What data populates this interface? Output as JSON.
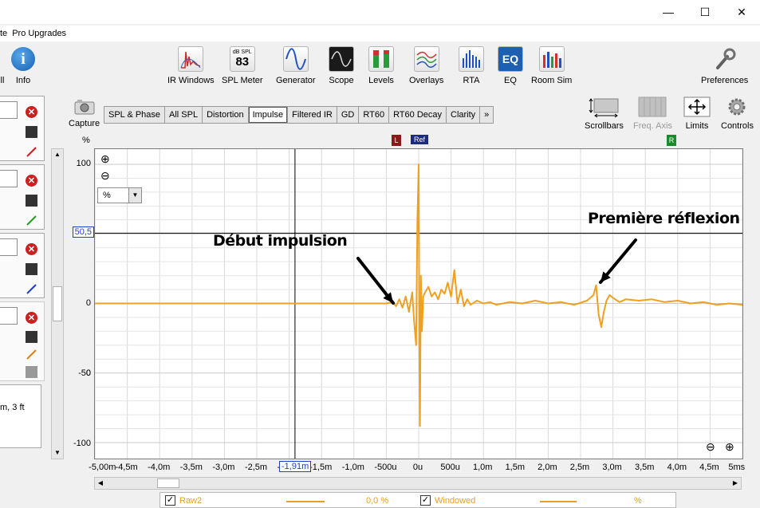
{
  "menu": {
    "items": [
      "te",
      "Pro Upgrades"
    ]
  },
  "window_controls": {
    "minimize": "—",
    "maximize": "☐",
    "close": "✕"
  },
  "toolbar": {
    "left_labels": [
      "ll",
      "Info"
    ],
    "buttons": [
      {
        "label": "IR Windows",
        "icon": "ir-windows-icon"
      },
      {
        "label": "SPL Meter",
        "icon": "spl-meter-icon",
        "icon_text_top": "dB SPL",
        "icon_text_value": "83"
      },
      {
        "label": "Generator",
        "icon": "generator-icon"
      },
      {
        "label": "Scope",
        "icon": "scope-icon"
      },
      {
        "label": "Levels",
        "icon": "levels-icon"
      },
      {
        "label": "Overlays",
        "icon": "overlays-icon"
      },
      {
        "label": "RTA",
        "icon": "rta-icon"
      },
      {
        "label": "EQ",
        "icon": "eq-icon",
        "icon_text": "EQ"
      },
      {
        "label": "Room Sim",
        "icon": "room-sim-icon"
      },
      {
        "label": "Preferences",
        "icon": "preferences-icon"
      }
    ]
  },
  "left_panel": {
    "info_text": "m, 3 ft",
    "line_colors": [
      "#d02020",
      "#20a020",
      "#2040c0",
      "#e08020"
    ]
  },
  "capture": {
    "label": "Capture"
  },
  "tabs": {
    "items": [
      "SPL & Phase",
      "All SPL",
      "Distortion",
      "Impulse",
      "Filtered IR",
      "GD",
      "RT60",
      "RT60 Decay",
      "Clarity",
      "»"
    ],
    "active": "Impulse"
  },
  "right_controls": {
    "scrollbars": "Scrollbars",
    "freq_axis": "Freq. Axis",
    "limits": "Limits",
    "controls": "Controls"
  },
  "plot": {
    "y_unit": "%",
    "unit_select": "%",
    "cursor_y": "50,5",
    "cursor_x": "-1,91m",
    "markers": {
      "left": "L",
      "ref": "Ref",
      "right": "R"
    },
    "annotations": {
      "start": "Début impulsion",
      "reflection": "Première réflexion"
    },
    "zoom_in": "⊕",
    "zoom_out": "⊖"
  },
  "chart_data": {
    "type": "line",
    "x_unit": "ms",
    "y_unit": "%",
    "xlim": [
      -5.0,
      5.0
    ],
    "ylim": [
      -100,
      100
    ],
    "y_ticks": [
      "100",
      "50",
      "0",
      "-50",
      "-100"
    ],
    "x_ticks": [
      "-5,00m",
      "-4,5m",
      "-4,0m",
      "-3,5m",
      "-3,0m",
      "-2,5m",
      "-2,0m",
      "-1,5m",
      "-1,0m",
      "-500u",
      "0u",
      "500u",
      "1,0m",
      "1,5m",
      "2,0m",
      "2,5m",
      "3,0m",
      "3,5m",
      "4,0m",
      "4,5m",
      "5ms"
    ],
    "color": "#f0a020",
    "series": [
      {
        "x": [
          -5.0,
          -0.5,
          -0.4,
          -0.35,
          -0.3,
          -0.25,
          -0.2,
          -0.15,
          -0.1,
          -0.07,
          -0.04,
          -0.02,
          0.0,
          0.01,
          0.02,
          0.035,
          0.05,
          0.07,
          0.1,
          0.15,
          0.2,
          0.25,
          0.3,
          0.35,
          0.4,
          0.45,
          0.5,
          0.55,
          0.6,
          0.65,
          0.7,
          0.75,
          0.8,
          0.9,
          1.0,
          1.1,
          1.2,
          1.4,
          1.6,
          1.8,
          2.0,
          2.2,
          2.4,
          2.6,
          2.7,
          2.74,
          2.78,
          2.82,
          2.86,
          2.9,
          2.95,
          3.0,
          3.1,
          3.2,
          3.4,
          3.6,
          3.8,
          4.0,
          4.2,
          4.4,
          4.6,
          4.8,
          5.0
        ],
        "y": [
          0,
          0,
          1,
          -2,
          3,
          -3,
          5,
          -6,
          8,
          -13,
          -30,
          60,
          100,
          -30,
          -88,
          20,
          -20,
          5,
          8,
          12,
          5,
          8,
          3,
          10,
          7,
          15,
          5,
          24,
          0,
          10,
          -2,
          3,
          -1,
          2,
          0,
          1,
          -1,
          1,
          0,
          2,
          0,
          1,
          -1,
          2,
          6,
          13,
          -8,
          -17,
          -6,
          2,
          6,
          4,
          1,
          3,
          2,
          3,
          1,
          2,
          0,
          1,
          -1,
          0,
          -1
        ]
      }
    ]
  },
  "legend": {
    "items": [
      {
        "checked": "✓",
        "name": "Raw2",
        "value": "0,0 %"
      },
      {
        "checked": "✓",
        "name": "Windowed",
        "value": "%"
      }
    ]
  }
}
